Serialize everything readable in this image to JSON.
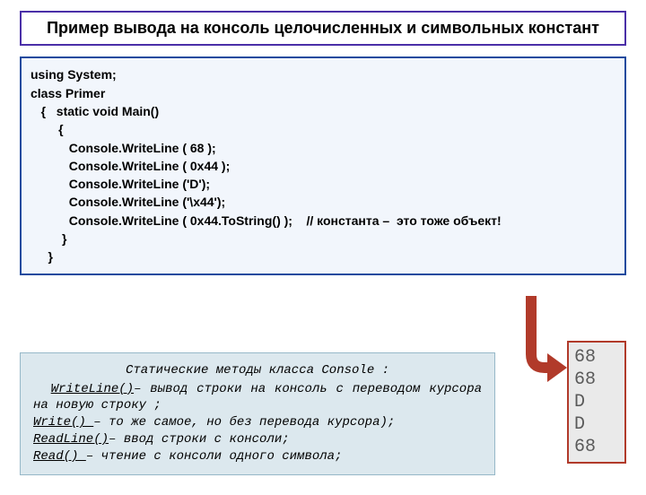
{
  "title": "Пример вывода на консоль целочисленных\nи символьных констант",
  "code": "using System;\nclass Primer\n   {   static void Main()\n        {\n           Console.WriteLine ( 68 );\n           Console.WriteLine ( 0x44 );\n           Console.WriteLine ('D');\n           Console.WriteLine ('\\x44');\n           Console.WriteLine ( 0x44.ToString() );    // константа –  это тоже объект!\n         }\n     }",
  "note": {
    "header": "Статические методы класса Console :",
    "m1": "WriteLine()",
    "t1": "– вывод строки на консоль с переводом  курсора на новую строку ;",
    "m2": "Write() ",
    "t2": "– то же самое, но без перевода курсора);",
    "m3": "ReadLine()",
    "t3": "– ввод строки с консоли;",
    "m4": "Read() ",
    "t4": "– чтение с консоли одного символа;"
  },
  "output": "68\n68\nD\nD\n68"
}
